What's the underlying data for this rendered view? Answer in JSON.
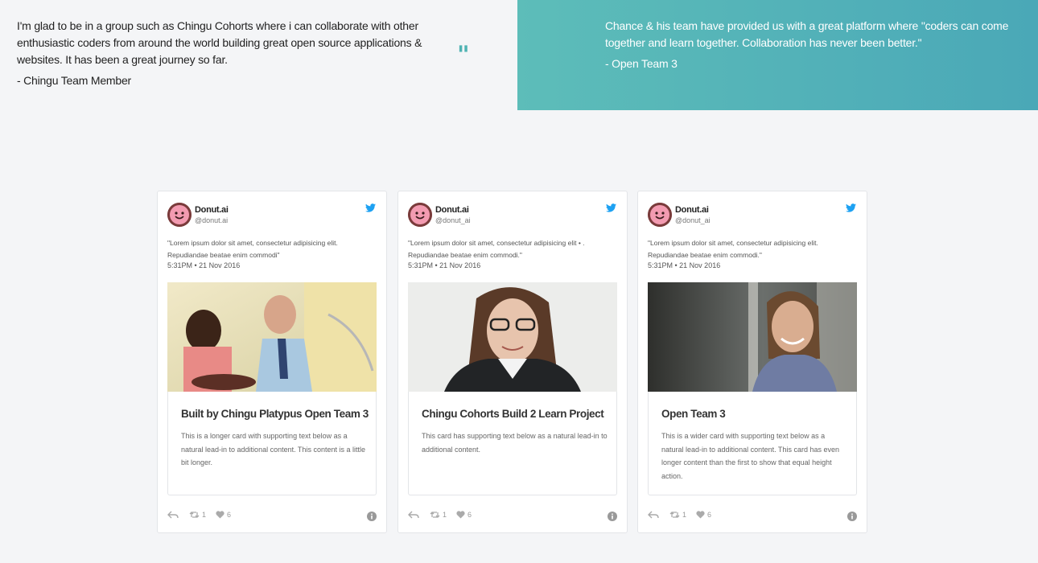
{
  "testimonials": {
    "left": {
      "quote": "I'm glad to be in a group such as Chingu Cohorts where i can collaborate with other enthusiastic coders from around the world building great open source applications & websites. It has been a great journey so far.",
      "author": "- Chingu Team Member",
      "quote_mark": "\""
    },
    "right": {
      "quote": "Chance & his team have provided us with a great platform where \"coders can come together and learn together. Collaboration has never been better.\"",
      "author": "- Open Team 3"
    }
  },
  "cards": [
    {
      "name": "Donut.ai",
      "handle": "@donut.ai",
      "text": "\"Lorem ipsum dolor sit amet, consectetur adipisicing elit. Repudiandae beatae enim commodi\"",
      "time": "5:31PM • 21 Nov 2016",
      "photo_icon": "couple-cooking-photo",
      "title": "Built by Chingu Platypus Open Team 3",
      "body": "This is a longer card with supporting text below as a natural lead-in to additional content. This content is a little bit longer.",
      "retweets": "1",
      "likes": "6"
    },
    {
      "name": "Donut.ai",
      "handle": "@donut_ai",
      "text": "\"Lorem ipsum dolor sit amet, consectetur adipisicing elit • . Repudiandae beatae enim commodi.\"",
      "time": "5:31PM • 21 Nov 2016",
      "photo_icon": "woman-glasses-photo",
      "title": "Chingu Cohorts Build 2 Learn Project",
      "body": "This card has supporting text below as a natural lead-in to additional content.",
      "retweets": "1",
      "likes": "6"
    },
    {
      "name": "Donut.ai",
      "handle": "@donut_ai",
      "text": "\"Lorem ipsum dolor sit amet, consectetur adipisicing elit. Repudiandae beatae enim commodi.\"",
      "time": "5:31PM • 21 Nov 2016",
      "photo_icon": "woman-office-photo",
      "title": "Open Team 3",
      "body": "This is a wider card with supporting text below as a natural lead-in to additional content. This card has even longer content than the first to show that equal height action.",
      "retweets": "1",
      "likes": "6"
    }
  ],
  "colors": {
    "accent_teal": "#4fb3b3",
    "twitter_blue": "#1da1f2",
    "band_gradient_start": "#5dbdb9",
    "band_gradient_end": "#4aa8b7"
  }
}
